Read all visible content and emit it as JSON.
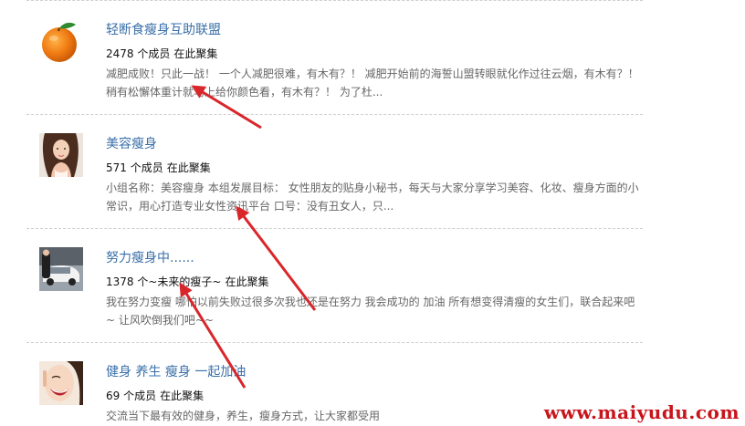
{
  "groups": [
    {
      "name": "轻断食瘦身互助联盟",
      "members": "2478 个成员",
      "gathering": "在此聚集",
      "description": "减肥成败！只此一战！ 一个人减肥很难，有木有？！ 减肥开始前的海誓山盟转眼就化作过往云烟，有木有？！ 稍有松懈体重计就马上给你颜色看，有木有？！ 为了杜..."
    },
    {
      "name": "美容瘦身",
      "members": "571 个成员",
      "gathering": "在此聚集",
      "description": "小组名称：美容瘦身 本组发展目标： 女性朋友的贴身小秘书，每天与大家分享学习美容、化妆、瘦身方面的小常识，用心打造专业女性资讯平台 口号：没有丑女人，只..."
    },
    {
      "name": "努力瘦身中......",
      "members": "1378 个~未来的瘦子~",
      "gathering": "在此聚集",
      "description": "我在努力变瘦 哪怕以前失败过很多次我也还是在努力 我会成功的 加油 所有想变得清瘦的女生们，联合起来吧~ 让风吹倒我们吧~~"
    },
    {
      "name": "健身 养生 瘦身 一起加油",
      "members": "69 个成员",
      "gathering": "在此聚集",
      "description": "交流当下最有效的健身，养生，瘦身方式，让大家都受用"
    }
  ],
  "watermark": "www.maiyudu.com",
  "colors": {
    "link": "#3a6fa8",
    "text": "#111111",
    "muted": "#666666",
    "arrow": "#d9262a",
    "watermark": "#c8141b"
  }
}
